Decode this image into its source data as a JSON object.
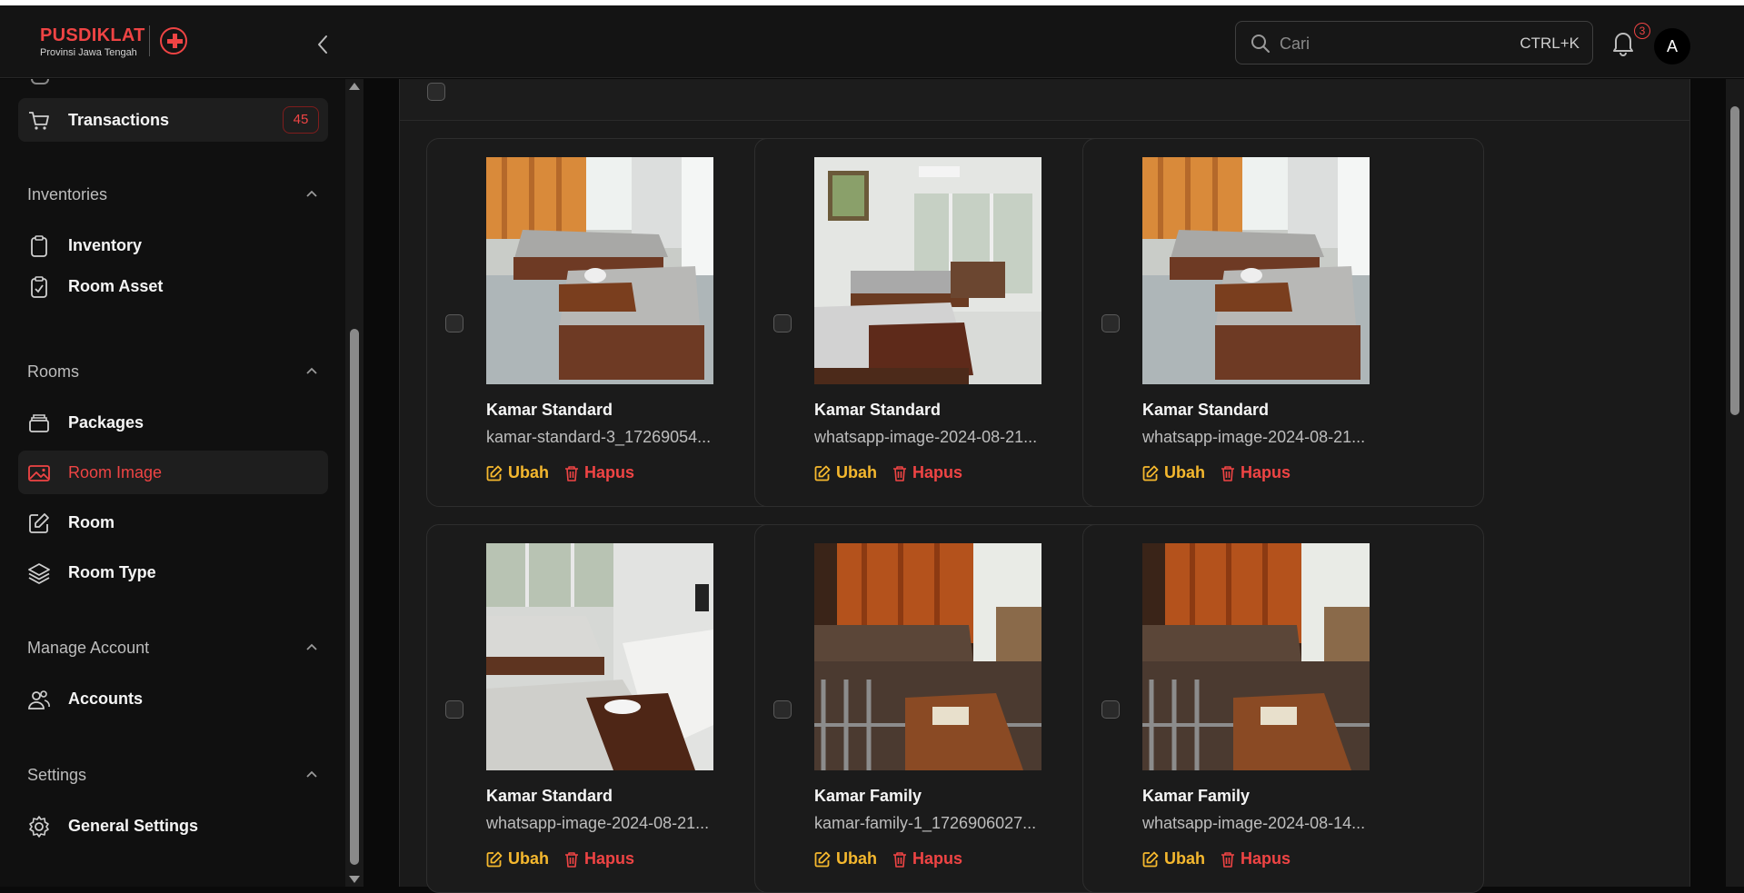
{
  "brand": {
    "title": "PUSDIKLAT",
    "subtitle": "Provinsi Jawa Tengah"
  },
  "search": {
    "placeholder": "Cari",
    "shortcut": "CTRL+K"
  },
  "notifications": {
    "count": "3"
  },
  "user": {
    "initial": "A"
  },
  "sidebar": {
    "transactions": {
      "label": "Transactions",
      "count": "45",
      "icon": "cart-icon"
    },
    "sections": [
      {
        "title": "Inventories",
        "items": [
          {
            "label": "Inventory",
            "icon": "clipboard-icon"
          },
          {
            "label": "Room Asset",
            "icon": "clipboard-check-icon"
          }
        ]
      },
      {
        "title": "Rooms",
        "items": [
          {
            "label": "Packages",
            "icon": "stack-icon"
          },
          {
            "label": "Room Image",
            "icon": "image-icon",
            "active": true
          },
          {
            "label": "Room",
            "icon": "edit-icon"
          },
          {
            "label": "Room Type",
            "icon": "layers-icon"
          }
        ]
      },
      {
        "title": "Manage Account",
        "items": [
          {
            "label": "Accounts",
            "icon": "users-icon"
          }
        ]
      },
      {
        "title": "Settings",
        "items": [
          {
            "label": "General Settings",
            "icon": "cog-icon"
          }
        ]
      }
    ]
  },
  "actions": {
    "edit": "Ubah",
    "delete": "Hapus"
  },
  "cards": [
    {
      "title": "Kamar Standard",
      "file": "kamar-standard-3_17269054..."
    },
    {
      "title": "Kamar Standard",
      "file": "whatsapp-image-2024-08-21..."
    },
    {
      "title": "Kamar Standard",
      "file": "whatsapp-image-2024-08-21..."
    },
    {
      "title": "Kamar Standard",
      "file": "whatsapp-image-2024-08-21..."
    },
    {
      "title": "Kamar Family",
      "file": "kamar-family-1_1726906027..."
    },
    {
      "title": "Kamar Family",
      "file": "whatsapp-image-2024-08-14..."
    }
  ],
  "colors": {
    "accent": "#ef4444",
    "edit": "#f5b82e",
    "background": "#0a0a0a"
  }
}
